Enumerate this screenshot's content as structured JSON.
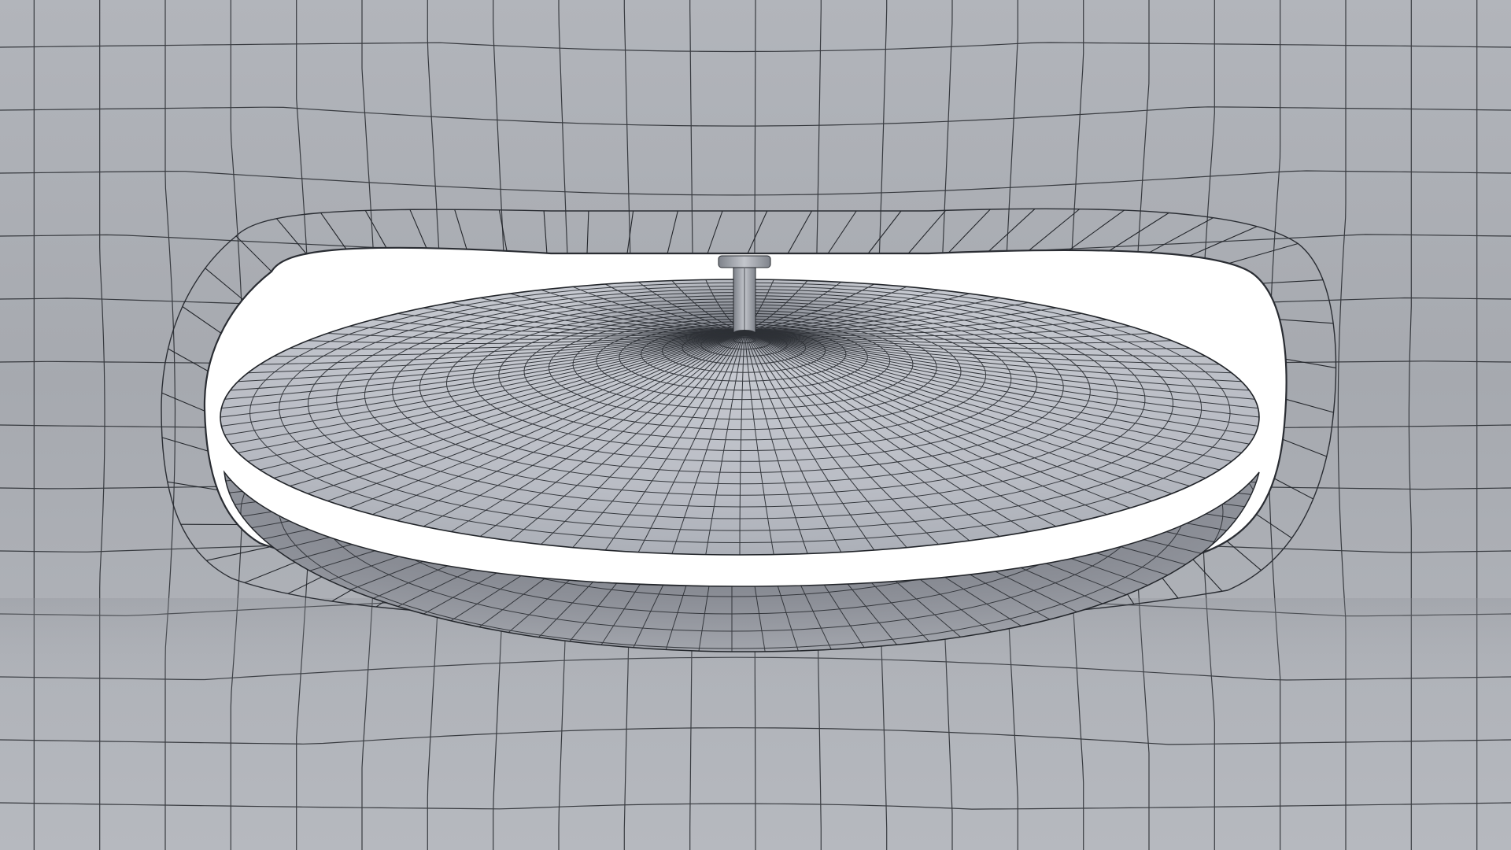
{
  "viewport": {
    "render_mode": "wireframe-on-shaded",
    "background_color": "#ffffff"
  },
  "scene": {
    "objects": [
      {
        "name": "surround-panel",
        "kind": "subdivided-panel",
        "color": "#a9acb2",
        "wire_color": "#1e2126"
      },
      {
        "name": "vent-opening",
        "kind": "rounded-slot"
      },
      {
        "name": "spindle",
        "kind": "cylinder",
        "color": "#9da1a8"
      },
      {
        "name": "upper-disc",
        "kind": "flared-cone",
        "color": "#b8bcc4",
        "radial_segments": 96,
        "rings": 22
      },
      {
        "name": "lower-disc",
        "kind": "flared-cone",
        "color": "#989ba2",
        "radial_segments": 96,
        "rings": 14
      }
    ]
  }
}
